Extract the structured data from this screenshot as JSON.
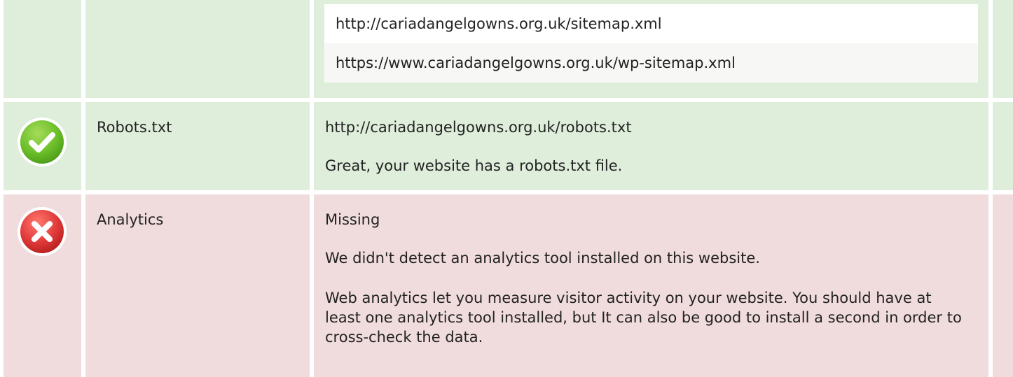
{
  "sitemaps": {
    "items": [
      "http://cariadangelgowns.org.uk/sitemap.xml",
      "https://www.cariadangelgowns.org.uk/wp-sitemap.xml"
    ]
  },
  "robots": {
    "status": "pass",
    "status_icon": "check-circle-icon",
    "label": "Robots.txt",
    "url": "http://cariadangelgowns.org.uk/robots.txt",
    "message": "Great, your website has a robots.txt file."
  },
  "analytics": {
    "status": "fail",
    "status_icon": "x-circle-icon",
    "label": "Analytics",
    "value": "Missing",
    "message": "We didn't detect an analytics tool installed on this website.",
    "advice": "Web analytics let you measure visitor activity on your website. You should have at least one analytics tool installed, but It can also be good to install a second in order to cross-check the data."
  },
  "colors": {
    "pass_bg": "#dfeedb",
    "fail_bg": "#f1dcdd",
    "pass_icon": "#6cbf2a",
    "fail_icon": "#e03a3a"
  }
}
